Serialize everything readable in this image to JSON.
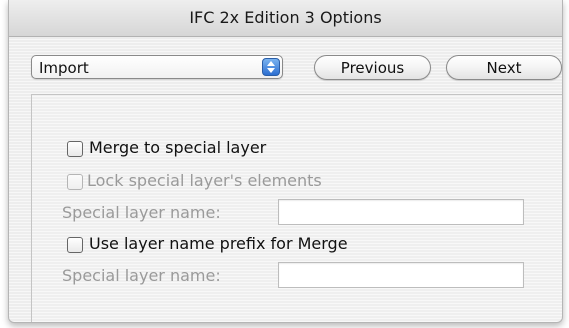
{
  "window": {
    "title": "IFC 2x Edition 3 Options"
  },
  "toolbar": {
    "section_select": {
      "value": "Import"
    },
    "previous_label": "Previous",
    "next_label": "Next"
  },
  "options": {
    "merge_special_layer": {
      "label": "Merge to special layer",
      "checked": false
    },
    "lock_special_elements": {
      "label": "Lock special layer's elements",
      "checked": false,
      "enabled": false
    },
    "special_layer_name_1": {
      "label": "Special layer name:",
      "value": ""
    },
    "use_prefix_merge": {
      "label": "Use layer name prefix for Merge",
      "checked": false
    },
    "special_layer_name_2": {
      "label": "Special layer name:",
      "value": ""
    }
  },
  "colors": {
    "accent": "#2d6fd1",
    "disabled_text": "#9a9a9a"
  },
  "icons": {
    "popup_arrows": "up-down-arrows-icon"
  }
}
